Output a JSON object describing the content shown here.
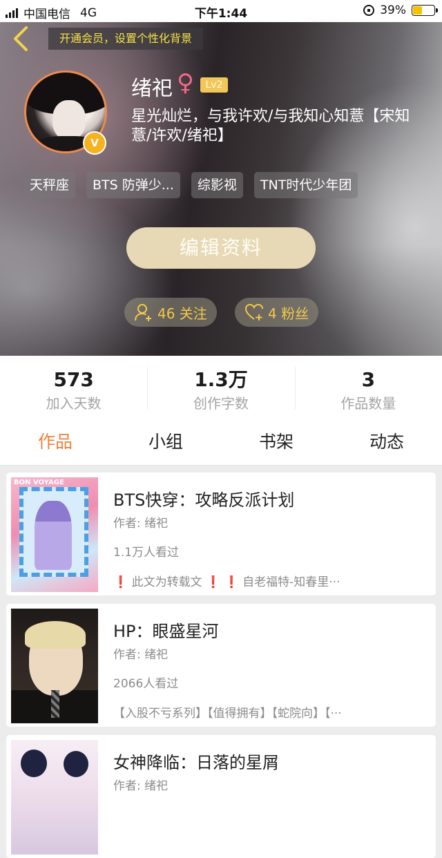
{
  "status": {
    "carrier": "中国电信",
    "network": "4G",
    "time": "下午1:44",
    "battery": "39%"
  },
  "header": {
    "vip_banner": "开通会员，设置个性化背景"
  },
  "profile": {
    "name": "绪祀",
    "gender_symbol": "♀",
    "level": "Lv2",
    "badge": "V",
    "bio": "星光灿烂，与我许欢/与我知心知薏【宋知薏/许欢/绪祀】",
    "tags": [
      "天秤座",
      "BTS 防弹少...",
      "综影视",
      "TNT时代少年团"
    ],
    "edit_button": "编辑资料",
    "following": "46 关注",
    "followers": "4 粉丝"
  },
  "stats": [
    {
      "value": "573",
      "label": "加入天数"
    },
    {
      "value": "1.3万",
      "label": "创作字数"
    },
    {
      "value": "3",
      "label": "作品数量"
    }
  ],
  "tabs": [
    "作品",
    "小组",
    "书架",
    "动态"
  ],
  "works": [
    {
      "title": "BTS快穿：攻略反派计划",
      "author": "作者: 绪祀",
      "views": "1.1万人看过",
      "tag_parts": [
        "❗",
        " 此文为转载文 ",
        "❗",
        " ",
        "❗",
        " 自老福特-知春里···"
      ]
    },
    {
      "title": "HP：眼盛星河",
      "author": "作者: 绪祀",
      "views": "2066人看过",
      "tag_parts": [
        "【入股不亏系列】【值得拥有】【蛇院向】【···"
      ]
    },
    {
      "title": "女神降临：日落的星屑",
      "author": "作者: 绪祀"
    }
  ],
  "colors": {
    "accent": "#f0803a",
    "vip_text": "#f4e24a",
    "follow_text": "#f2c94c",
    "edit_button": "#e7d9b6"
  }
}
